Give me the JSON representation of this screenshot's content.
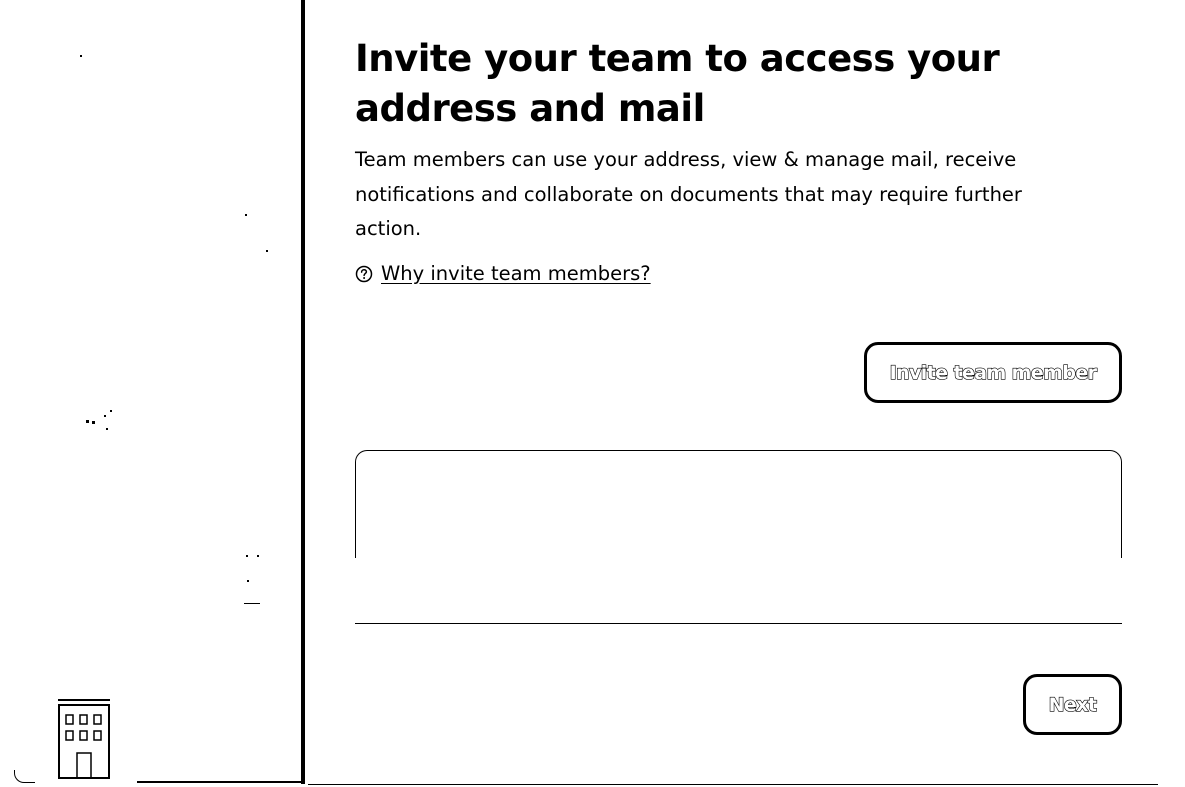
{
  "main": {
    "title": "Invite your team to access your address and mail",
    "description": "Team members can use your address, view & manage mail, receive notifications and collaborate on documents that may require further action.",
    "why_link": "Why invite team members?",
    "invite_button": "Invite team member",
    "next_button": "Next"
  },
  "icons": {
    "help": "question-circle-icon",
    "building": "building-icon"
  }
}
